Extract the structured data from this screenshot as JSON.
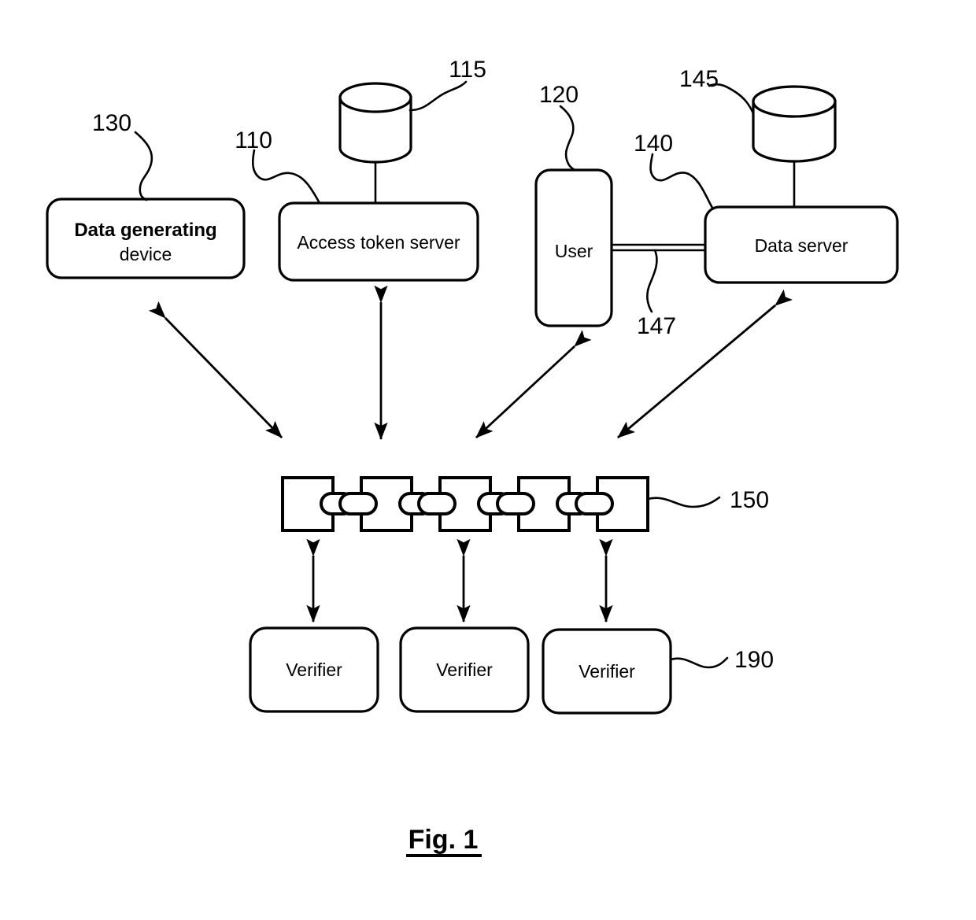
{
  "figure": {
    "caption": "Fig. 1",
    "title": "Fig. 1"
  },
  "nodes": {
    "data_generating_device": {
      "label_line1": "Data generating",
      "label_line2": "device",
      "ref": "130"
    },
    "access_token_server": {
      "label": "Access token server",
      "ref": "110"
    },
    "access_token_db": {
      "ref": "115",
      "icon": "database-cylinder-icon"
    },
    "user": {
      "label": "User",
      "ref": "120"
    },
    "data_server": {
      "label": "Data server",
      "ref": "140"
    },
    "data_server_db": {
      "ref": "145",
      "icon": "database-cylinder-icon"
    },
    "user_data_server_link": {
      "ref": "147"
    },
    "blockchain": {
      "ref": "150",
      "icon": "chain-link-icon",
      "block_count": 5,
      "link_count": 4
    },
    "verifiers": {
      "ref": "190",
      "items": [
        {
          "label": "Verifier"
        },
        {
          "label": "Verifier"
        },
        {
          "label": "Verifier"
        }
      ]
    }
  },
  "colors": {
    "stroke": "#000000",
    "fill": "#ffffff",
    "text": "#000000"
  }
}
